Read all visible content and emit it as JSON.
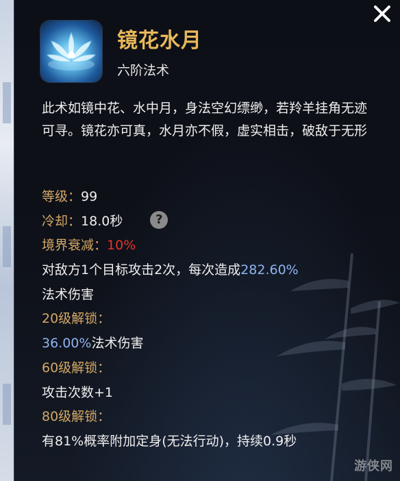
{
  "skill": {
    "name": "镜花水月",
    "tier": "六阶法术",
    "icon": "lotus-icon",
    "description": "此术如镜中花、水中月，身法空幻缥缈，若羚羊挂角无迹可寻。镜花亦可真，水月亦不假，虚实相击，破敌于无形"
  },
  "stats": {
    "level_label": "等级：",
    "level_value": "99",
    "cooldown_label": "冷却：",
    "cooldown_value": "18.0秒",
    "help_icon": "question-icon",
    "decay_label": "境界衰减：",
    "decay_value": "10%",
    "effect_prefix": "对敌方1个目标攻击2次，每次造成",
    "effect_value": "282.60%",
    "effect_suffix": "法术伤害",
    "unlock20_label": "20级解锁：",
    "unlock20_value": "36.00%",
    "unlock20_suffix": "法术伤害",
    "unlock60_label": "60级解锁：",
    "unlock60_text": "攻击次数+1",
    "unlock80_label": "80级解锁：",
    "unlock80_text": "有81%概率附加定身(无法行动)，持续0.9秒"
  },
  "watermark": "游侠网",
  "colors": {
    "title": "#e8b85a",
    "label": "#d4a866",
    "highlight_red": "#e8322c",
    "highlight_blue": "#8fb4f0"
  }
}
